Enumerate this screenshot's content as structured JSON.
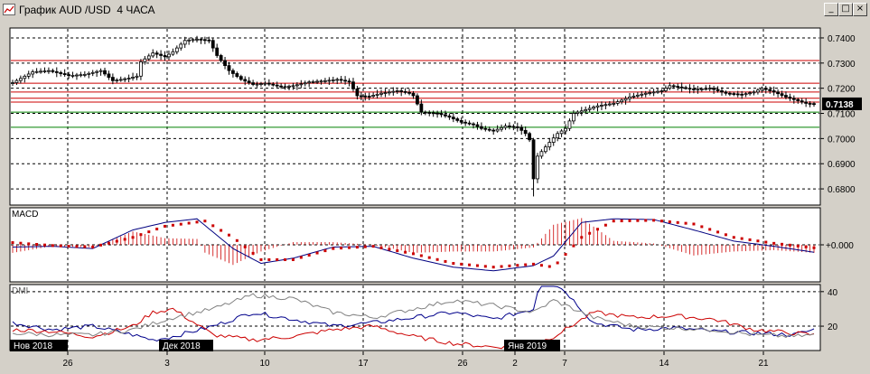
{
  "window": {
    "title": "График AUD /USD  4 ЧАСА",
    "icon": "chart-window-icon",
    "buttons": {
      "minimize": "_",
      "maximize": "□",
      "close": "×"
    }
  },
  "chart_data": [
    {
      "type": "candlestick",
      "panel": "price",
      "title": "",
      "y_ticks": [
        "0.7400",
        "0.7300",
        "0.7200",
        "0.7100",
        "0.7000",
        "0.6900",
        "0.6800"
      ],
      "ylim": [
        0.675,
        0.7425
      ],
      "current_price_label": "0.7138",
      "horizontal_levels": [
        {
          "value": 0.731,
          "color": "#cc0000"
        },
        {
          "value": 0.722,
          "color": "#cc0000"
        },
        {
          "value": 0.7185,
          "color": "#cc0000"
        },
        {
          "value": 0.716,
          "color": "#cc0000"
        },
        {
          "value": 0.7145,
          "color": "#cc0000"
        },
        {
          "value": 0.7105,
          "color": "#008000"
        },
        {
          "value": 0.7045,
          "color": "#008000"
        }
      ],
      "price_path": [
        [
          0,
          0.7222
        ],
        [
          5,
          0.7265
        ],
        [
          9,
          0.727
        ],
        [
          14,
          0.725
        ],
        [
          18,
          0.7255
        ],
        [
          22,
          0.727
        ],
        [
          25,
          0.723
        ],
        [
          29,
          0.724
        ],
        [
          31,
          0.7248
        ],
        [
          32,
          0.7305
        ],
        [
          35,
          0.734
        ],
        [
          38,
          0.7325
        ],
        [
          40,
          0.7345
        ],
        [
          43,
          0.739
        ],
        [
          46,
          0.7395
        ],
        [
          49,
          0.739
        ],
        [
          51,
          0.733
        ],
        [
          54,
          0.727
        ],
        [
          57,
          0.7235
        ],
        [
          60,
          0.7215
        ],
        [
          63,
          0.722
        ],
        [
          67,
          0.7205
        ],
        [
          70,
          0.721
        ],
        [
          74,
          0.7225
        ],
        [
          78,
          0.723
        ],
        [
          81,
          0.7235
        ],
        [
          84,
          0.7225
        ],
        [
          86,
          0.717
        ],
        [
          89,
          0.7168
        ],
        [
          92,
          0.718
        ],
        [
          96,
          0.719
        ],
        [
          99,
          0.718
        ],
        [
          100,
          0.717
        ],
        [
          102,
          0.7105
        ],
        [
          106,
          0.71
        ],
        [
          109,
          0.7085
        ],
        [
          112,
          0.7065
        ],
        [
          115,
          0.7055
        ],
        [
          117,
          0.704
        ],
        [
          120,
          0.703
        ],
        [
          123,
          0.705
        ],
        [
          126,
          0.7045
        ],
        [
          128,
          0.702
        ],
        [
          129,
          0.6995
        ],
        [
          130,
          0.684
        ],
        [
          131,
          0.693
        ],
        [
          134,
          0.6985
        ],
        [
          136,
          0.702
        ],
        [
          138,
          0.704
        ],
        [
          140,
          0.71
        ],
        [
          142,
          0.711
        ],
        [
          146,
          0.713
        ],
        [
          150,
          0.714
        ],
        [
          154,
          0.7165
        ],
        [
          158,
          0.718
        ],
        [
          162,
          0.719
        ],
        [
          164,
          0.721
        ],
        [
          166,
          0.7205
        ],
        [
          170,
          0.7195
        ],
        [
          174,
          0.72
        ],
        [
          178,
          0.718
        ],
        [
          182,
          0.7175
        ],
        [
          185,
          0.7185
        ],
        [
          187,
          0.72
        ],
        [
          190,
          0.7185
        ],
        [
          193,
          0.7165
        ],
        [
          196,
          0.715
        ],
        [
          198,
          0.714
        ],
        [
          200,
          0.7138
        ]
      ],
      "spike_low": {
        "index": 130,
        "value": 0.677
      }
    },
    {
      "type": "line",
      "panel": "MACD",
      "title": "MACD",
      "y_ticks": [
        "+0.000"
      ],
      "ylim": [
        -0.0045,
        0.0045
      ],
      "series": [
        {
          "color": "#cc0000",
          "style": "dotted-markers",
          "path": [
            [
              0,
              0.0003
            ],
            [
              10,
              -0.0001
            ],
            [
              20,
              -0.0003
            ],
            [
              30,
              0.001
            ],
            [
              38,
              0.0025
            ],
            [
              48,
              0.0032
            ],
            [
              55,
              0.001
            ],
            [
              62,
              -0.002
            ],
            [
              70,
              -0.002
            ],
            [
              80,
              -0.0005
            ],
            [
              90,
              -0.0002
            ],
            [
              100,
              -0.0012
            ],
            [
              110,
              -0.0025
            ],
            [
              120,
              -0.003
            ],
            [
              130,
              -0.0026
            ],
            [
              135,
              -0.003
            ],
            [
              142,
              0.001
            ],
            [
              150,
              0.0032
            ],
            [
              160,
              0.0033
            ],
            [
              170,
              0.0028
            ],
            [
              180,
              0.001
            ],
            [
              190,
              0.0002
            ],
            [
              200,
              -0.0004
            ]
          ]
        },
        {
          "color": "#000080",
          "style": "line",
          "path": [
            [
              0,
              -0.0003
            ],
            [
              10,
              -0.0002
            ],
            [
              20,
              -0.0005
            ],
            [
              30,
              0.002
            ],
            [
              38,
              0.003
            ],
            [
              46,
              0.0035
            ],
            [
              55,
              -0.0005
            ],
            [
              62,
              -0.0025
            ],
            [
              70,
              -0.0018
            ],
            [
              80,
              -0.0003
            ],
            [
              90,
              -0.0002
            ],
            [
              100,
              -0.0018
            ],
            [
              110,
              -0.003
            ],
            [
              120,
              -0.0035
            ],
            [
              130,
              -0.0028
            ],
            [
              135,
              -0.0015
            ],
            [
              142,
              0.003
            ],
            [
              150,
              0.0035
            ],
            [
              160,
              0.0034
            ],
            [
              170,
              0.002
            ],
            [
              180,
              0.0005
            ],
            [
              190,
              -0.0002
            ],
            [
              200,
              -0.001
            ]
          ]
        }
      ]
    },
    {
      "type": "line",
      "panel": "DMI",
      "title": "DMI",
      "y_ticks": [
        "40",
        "20"
      ],
      "ylim": [
        8,
        42
      ],
      "series": [
        {
          "color": "#00008b",
          "path": [
            [
              0,
              22
            ],
            [
              10,
              18
            ],
            [
              20,
              20
            ],
            [
              30,
              15
            ],
            [
              35,
              12
            ],
            [
              40,
              14
            ],
            [
              50,
              20
            ],
            [
              60,
              28
            ],
            [
              70,
              24
            ],
            [
              80,
              20
            ],
            [
              90,
              22
            ],
            [
              100,
              25
            ],
            [
              110,
              28
            ],
            [
              120,
              24
            ],
            [
              130,
              30
            ],
            [
              132,
              50
            ],
            [
              138,
              40
            ],
            [
              145,
              22
            ],
            [
              155,
              18
            ],
            [
              165,
              19
            ],
            [
              175,
              17
            ],
            [
              185,
              16
            ],
            [
              195,
              15
            ],
            [
              200,
              18
            ]
          ]
        },
        {
          "color": "#cc0000",
          "path": [
            [
              0,
              18
            ],
            [
              10,
              17
            ],
            [
              20,
              14
            ],
            [
              30,
              20
            ],
            [
              35,
              28
            ],
            [
              40,
              30
            ],
            [
              50,
              15
            ],
            [
              60,
              12
            ],
            [
              70,
              14
            ],
            [
              80,
              18
            ],
            [
              90,
              20
            ],
            [
              100,
              14
            ],
            [
              110,
              10
            ],
            [
              120,
              8
            ],
            [
              130,
              9
            ],
            [
              135,
              14
            ],
            [
              145,
              28
            ],
            [
              155,
              25
            ],
            [
              165,
              26
            ],
            [
              175,
              24
            ],
            [
              185,
              18
            ],
            [
              195,
              16
            ],
            [
              200,
              15
            ]
          ]
        },
        {
          "color": "#808080",
          "path": [
            [
              0,
              16
            ],
            [
              10,
              15
            ],
            [
              20,
              15
            ],
            [
              30,
              18
            ],
            [
              40,
              25
            ],
            [
              50,
              30
            ],
            [
              60,
              38
            ],
            [
              70,
              36
            ],
            [
              80,
              28
            ],
            [
              90,
              25
            ],
            [
              100,
              30
            ],
            [
              110,
              35
            ],
            [
              120,
              32
            ],
            [
              130,
              28
            ],
            [
              135,
              35
            ],
            [
              145,
              25
            ],
            [
              155,
              20
            ],
            [
              165,
              19
            ],
            [
              175,
              18
            ],
            [
              185,
              15
            ],
            [
              195,
              14
            ],
            [
              200,
              15
            ]
          ]
        }
      ]
    }
  ],
  "x_axis": {
    "day_labels": [
      "26",
      "3",
      "10",
      "17",
      "26",
      "2",
      "7",
      "14",
      "21"
    ],
    "month_labels": [
      "Нов 2018",
      "Дек 2018",
      "Янв 2019"
    ]
  }
}
